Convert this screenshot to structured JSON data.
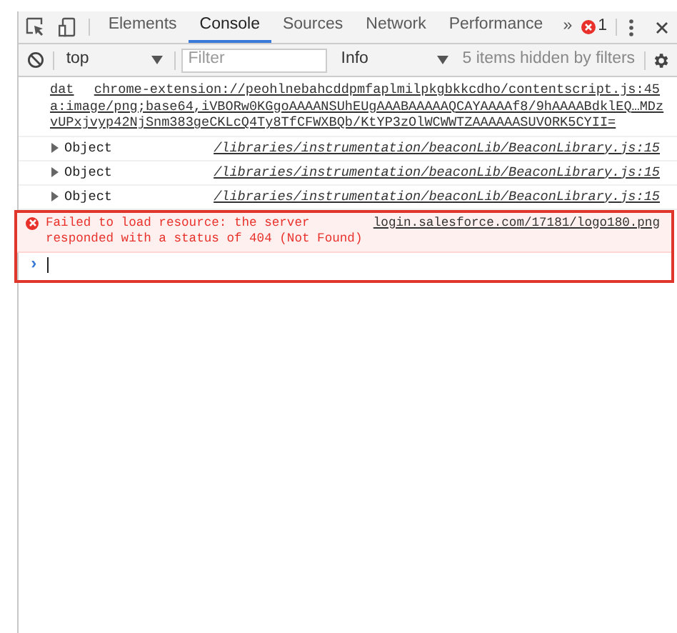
{
  "tabs": [
    {
      "label": "Elements",
      "selected": false
    },
    {
      "label": "Console",
      "selected": true
    },
    {
      "label": "Sources",
      "selected": false
    },
    {
      "label": "Network",
      "selected": false
    },
    {
      "label": "Performance",
      "selected": false
    }
  ],
  "more_tabs": "»",
  "error_count": "1",
  "toolbar": {
    "context": "top",
    "filter": {
      "placeholder": "Filter"
    },
    "level": "Info",
    "hidden_note": "5 items hidden by filters"
  },
  "messages": [
    {
      "kind": "data_url",
      "lines": [
        "dat",
        "a:image/png;base64,iVBORw0KGgoAAAANSUhEUgAAABAAAAAQCAYAAAAf8/9hAAAABdklEQ…MDz",
        "vUPxjvyp42NjSnm383geCKLcQ4Ty8TfCFWXBQb/KtYP3zOlWCWWTZAAAAAASUVORK5CYII="
      ],
      "source": "chrome-extension://peohlnebahcddpmfaplmilpkgbkkcdho/contentscript.js:45"
    },
    {
      "kind": "object",
      "text": "Object",
      "expanded": false,
      "source": "/libraries/instrumentation/beaconLib/BeaconLibrary.js:15"
    },
    {
      "kind": "object",
      "text": "Object",
      "expanded": false,
      "source": "/libraries/instrumentation/beaconLib/BeaconLibrary.js:15"
    },
    {
      "kind": "object",
      "text": "Object",
      "expanded": false,
      "source": "/libraries/instrumentation/beaconLib/BeaconLibrary.js:15"
    },
    {
      "kind": "error",
      "lines": [
        "Failed to load resource: the server",
        "responded with a status of 404 (Not Found)"
      ],
      "source": "login.salesforce.com/17181/logo180.png"
    }
  ],
  "prompt": {
    "symbol": "›"
  }
}
